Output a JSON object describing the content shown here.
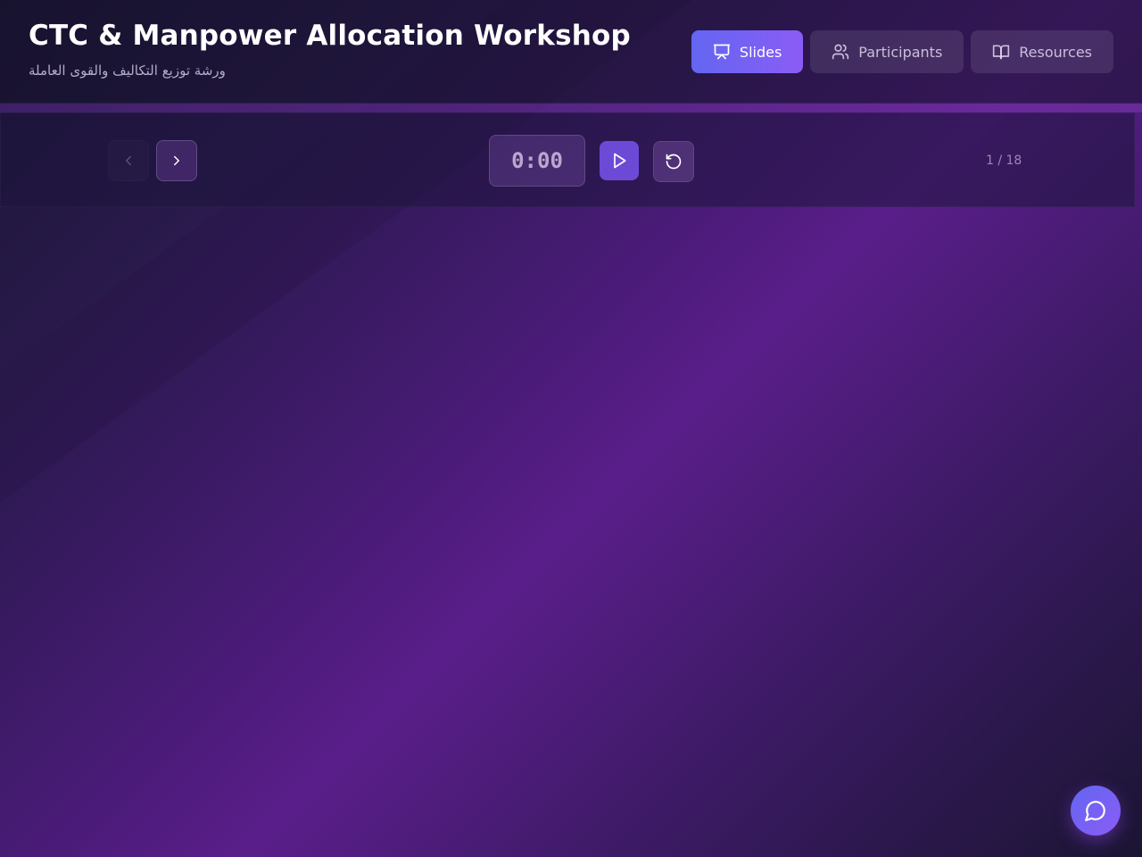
{
  "header": {
    "title": "CTC & Manpower Allocation Workshop",
    "subtitle": "ورشة توزيع التكاليف والقوى العاملة"
  },
  "nav": {
    "items": [
      {
        "label": "Slides",
        "icon": "presentation-icon",
        "active": true
      },
      {
        "label": "Participants",
        "icon": "users-icon",
        "active": false
      },
      {
        "label": "Resources",
        "icon": "book-open-icon",
        "active": false
      }
    ]
  },
  "controls": {
    "timer": "0:00",
    "slide_counter": "1 / 18",
    "prev_icon": "chevron-left-icon",
    "next_icon": "chevron-right-icon",
    "play_icon": "play-icon",
    "reset_icon": "rotate-ccw-icon"
  },
  "chat": {
    "icon": "message-circle-icon"
  },
  "colors": {
    "accent_start": "#6366f1",
    "accent_end": "#8b5cf6",
    "play_button": "#6d4ad6"
  }
}
